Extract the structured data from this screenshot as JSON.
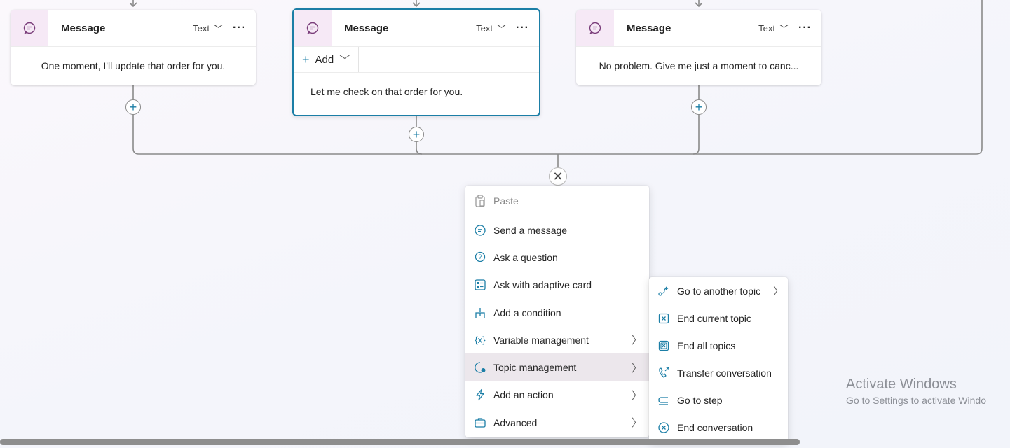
{
  "cards": [
    {
      "title": "Message",
      "type": "Text",
      "more": "···",
      "body": "One moment, I'll update that order for you."
    },
    {
      "title": "Message",
      "type": "Text",
      "more": "···",
      "add_label": "Add",
      "body": "Let me check on that order for you."
    },
    {
      "title": "Message",
      "type": "Text",
      "more": "···",
      "body": "No problem. Give me just a moment to canc..."
    }
  ],
  "menu": {
    "paste": "Paste",
    "items": [
      {
        "label": "Send a message",
        "icon": "chat-bubble-icon"
      },
      {
        "label": "Ask a question",
        "icon": "question-bubble-icon"
      },
      {
        "label": "Ask with adaptive card",
        "icon": "adaptive-card-icon"
      },
      {
        "label": "Add a condition",
        "icon": "branch-icon"
      },
      {
        "label": "Variable management",
        "icon": "variable-icon",
        "submenu": true
      },
      {
        "label": "Topic management",
        "icon": "topic-icon",
        "submenu": true,
        "active": true
      },
      {
        "label": "Add an action",
        "icon": "lightning-icon",
        "submenu": true
      },
      {
        "label": "Advanced",
        "icon": "toolbox-icon",
        "submenu": true
      }
    ]
  },
  "submenu": {
    "items": [
      {
        "label": "Go to another topic",
        "icon": "redirect-icon",
        "submenu": true
      },
      {
        "label": "End current topic",
        "icon": "end-topic-icon"
      },
      {
        "label": "End all topics",
        "icon": "end-all-icon"
      },
      {
        "label": "Transfer conversation",
        "icon": "phone-transfer-icon"
      },
      {
        "label": "Go to step",
        "icon": "goto-step-icon"
      },
      {
        "label": "End conversation",
        "icon": "end-conversation-icon"
      }
    ]
  },
  "watermark": {
    "line1": "Activate Windows",
    "line2": "Go to Settings to activate Windo"
  },
  "colors": {
    "accent": "#1b7ea6",
    "icon_bg": "#f6e9f6",
    "connector": "#8a8a8a",
    "active_item": "#ece7ec"
  }
}
